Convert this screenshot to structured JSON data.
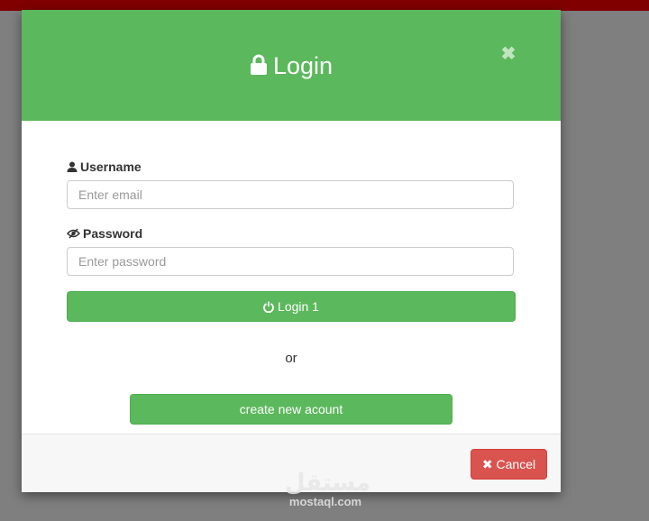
{
  "modal": {
    "title": "Login",
    "close_symbol": "✖"
  },
  "form": {
    "username_label": "Username",
    "username_placeholder": "Enter email",
    "password_label": "Password",
    "password_placeholder": "Enter password",
    "login_button": "Login 1",
    "or_text": "or",
    "create_button": "create new acount"
  },
  "footer": {
    "cancel_button": "Cancel",
    "cancel_icon": "✖"
  },
  "watermark": {
    "arabic": "مستقل",
    "latin": "mostaql.com"
  },
  "colors": {
    "header_green": "#5cb85c",
    "cancel_red": "#d9534f",
    "topbar": "#800000",
    "overlay": "#7f7f7f"
  },
  "icons": [
    "lock-icon",
    "close-icon",
    "user-icon",
    "eye-slash-icon",
    "power-icon",
    "times-icon"
  ]
}
